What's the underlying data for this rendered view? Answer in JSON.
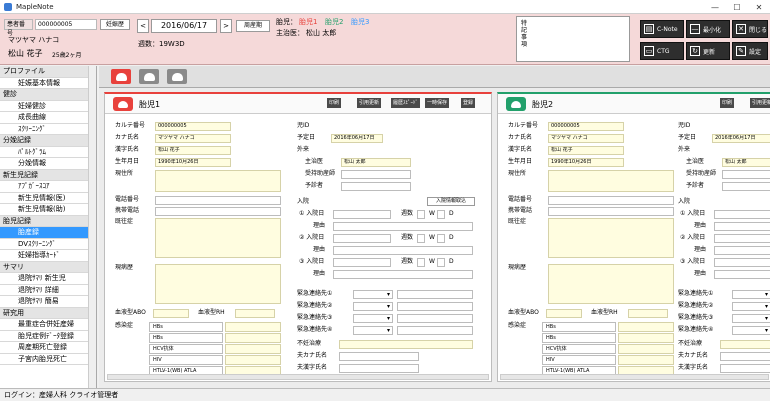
{
  "window": {
    "title": "MapleNote",
    "min": "—",
    "max": "☐",
    "close": "✕"
  },
  "colors": {
    "pink_header": "#f5d9d9",
    "active_nav": "#3399ff",
    "red_tab": "#e8413c",
    "green_tab": "#22a06b"
  },
  "patient": {
    "id_label": "患者番号",
    "id_value": "000000005",
    "kana": "マツヤマ ハナコ",
    "name": "松山 花子",
    "age": "25歳2ヶ月",
    "pregnancy_button": "妊娠歴"
  },
  "date": {
    "prev": "<",
    "value": "2016/06/17",
    "next": ">",
    "menstrual_button": "周産期",
    "weeks": "週数：19W3D"
  },
  "fetus": {
    "label": "胎児：",
    "f1": "胎児1",
    "f2": "胎児2",
    "f3": "胎児3",
    "doctor_label": "主治医：",
    "doctor": "松山 太郎"
  },
  "memo": {
    "label": "特記事項"
  },
  "toolbar": {
    "cnote": "C-Note",
    "min": "最小化",
    "close": "閉じる",
    "ctg": "CTG",
    "update": "更新",
    "settings": "設定"
  },
  "sidebar": {
    "items": [
      {
        "type": "cat",
        "label": "プロファイル"
      },
      {
        "type": "item",
        "label": "妊娠基本情報"
      },
      {
        "type": "cat",
        "label": "健診"
      },
      {
        "type": "item",
        "label": "妊婦健診"
      },
      {
        "type": "item",
        "label": "成長曲線"
      },
      {
        "type": "item",
        "label": "ｽｸﾘｰﾆﾝｸﾞ"
      },
      {
        "type": "cat",
        "label": "分娩記録"
      },
      {
        "type": "item",
        "label": "ﾊﾟﾙﾄｸﾞﾗﾑ"
      },
      {
        "type": "item",
        "label": "分娩情報"
      },
      {
        "type": "cat",
        "label": "新生児記録"
      },
      {
        "type": "item",
        "label": "ｱﾌﾟｶﾞｰｽｺｱ"
      },
      {
        "type": "item",
        "label": "新生児情報(医)"
      },
      {
        "type": "item",
        "label": "新生児情報(助)"
      },
      {
        "type": "cat",
        "label": "胎児記録"
      },
      {
        "type": "item",
        "label": "胎産録",
        "active": true
      },
      {
        "type": "item",
        "label": "DVｽｸﾘｰﾆﾝｸﾞ"
      },
      {
        "type": "item",
        "label": "妊婦指導ｶｰﾄﾞ"
      },
      {
        "type": "cat",
        "label": "サマリ"
      },
      {
        "type": "item",
        "label": "退院ｻﾏﾘ 新生児"
      },
      {
        "type": "item",
        "label": "退院ｻﾏﾘ 詳細"
      },
      {
        "type": "item",
        "label": "退院ｻﾏﾘ 簡易"
      },
      {
        "type": "cat",
        "label": "研究用"
      },
      {
        "type": "item",
        "label": "最重症合併妊産婦"
      },
      {
        "type": "item",
        "label": "胎児症例ﾃﾞｰﾀ登録"
      },
      {
        "type": "item",
        "label": "周産期死亡登録"
      },
      {
        "type": "item",
        "label": "子宮内胎児死亡"
      }
    ]
  },
  "panel1": {
    "title": "胎児1",
    "buttons": {
      "print": "印刷",
      "cite": "引用更新",
      "history": "履歴ｽﾋﾟｰﾄﾞ",
      "save_temp": "一時保存",
      "register": "登録"
    },
    "labels": {
      "karte": "カルテ番号",
      "kana": "カナ氏名",
      "kanji": "漢字氏名",
      "birth": "生年月日",
      "address": "現住所",
      "phone": "電話番号",
      "mobile": "携帯電話",
      "history": "既往症",
      "current": "現病歴",
      "blood_abo": "血液型ABO",
      "blood_rh": "血液型RH",
      "infection": "感染症",
      "child_id": "児ID",
      "due": "予定日",
      "outpatient": "外来",
      "doctor": "主治医",
      "reception": "受持助産師",
      "nurse": "予診者",
      "admission": "入院",
      "adm_info_button": "入院情報取込",
      "adm_date": "入院日",
      "reason": "理由",
      "weeks": "週数",
      "w": "W",
      "d": "D",
      "emergency": "緊急連絡先",
      "infertility": "不妊治療",
      "husband": "夫カナ氏名",
      "husband_kanji": "夫漢字氏名"
    },
    "values": {
      "karte": "000000005",
      "kana": "マツヤマ ハナコ",
      "kanji": "松山 花子",
      "birth": "1990年10月26日",
      "due": "2016年06月17日",
      "doctor": "松山 太郎"
    },
    "infections": [
      "HBs",
      "HBs",
      "HCV抗体",
      "HIV",
      "HTLV-1(WB) ATLA"
    ]
  },
  "panel2": {
    "title": "胎児2",
    "values": {
      "karte": "000000005",
      "kana": "マツヤマ ハナコ",
      "kanji": "松山 花子",
      "birth": "1990年10月26日",
      "due": "2016年06月17日",
      "doctor": "松山 太郎"
    }
  },
  "status": {
    "text": "ログイン：産婦人科 クライオ管理者"
  }
}
